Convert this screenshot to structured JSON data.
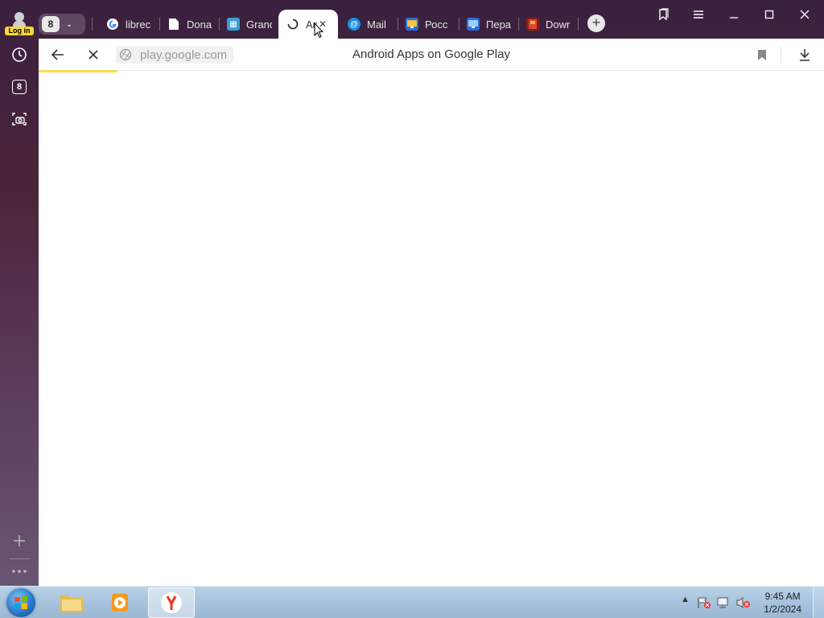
{
  "sidebar": {
    "login_label": "Log in",
    "tabs_count": "8"
  },
  "tabs": {
    "group_count": "8",
    "items": [
      {
        "label": "librec",
        "favicon": "google-icon"
      },
      {
        "label": "Dona",
        "favicon": "document-icon"
      },
      {
        "label": "Grand",
        "favicon": "grand-icon"
      },
      {
        "label": "An",
        "favicon": "loading-spinner-icon",
        "active": true
      },
      {
        "label": "Mail",
        "favicon": "mail-at-icon"
      },
      {
        "label": "Росс",
        "favicon": "monitor-icon"
      },
      {
        "label": "Пера",
        "favicon": "monitor-icon"
      },
      {
        "label": "Dowr",
        "favicon": "book-icon"
      }
    ]
  },
  "toolbar": {
    "url": "play.google.com",
    "page_title": "Android Apps on Google Play"
  },
  "taskbar": {
    "clock_time": "9:45 AM",
    "clock_date": "1/2/2024"
  },
  "colors": {
    "accent": "#ffdb4d",
    "login_badge": "#ffd633"
  }
}
